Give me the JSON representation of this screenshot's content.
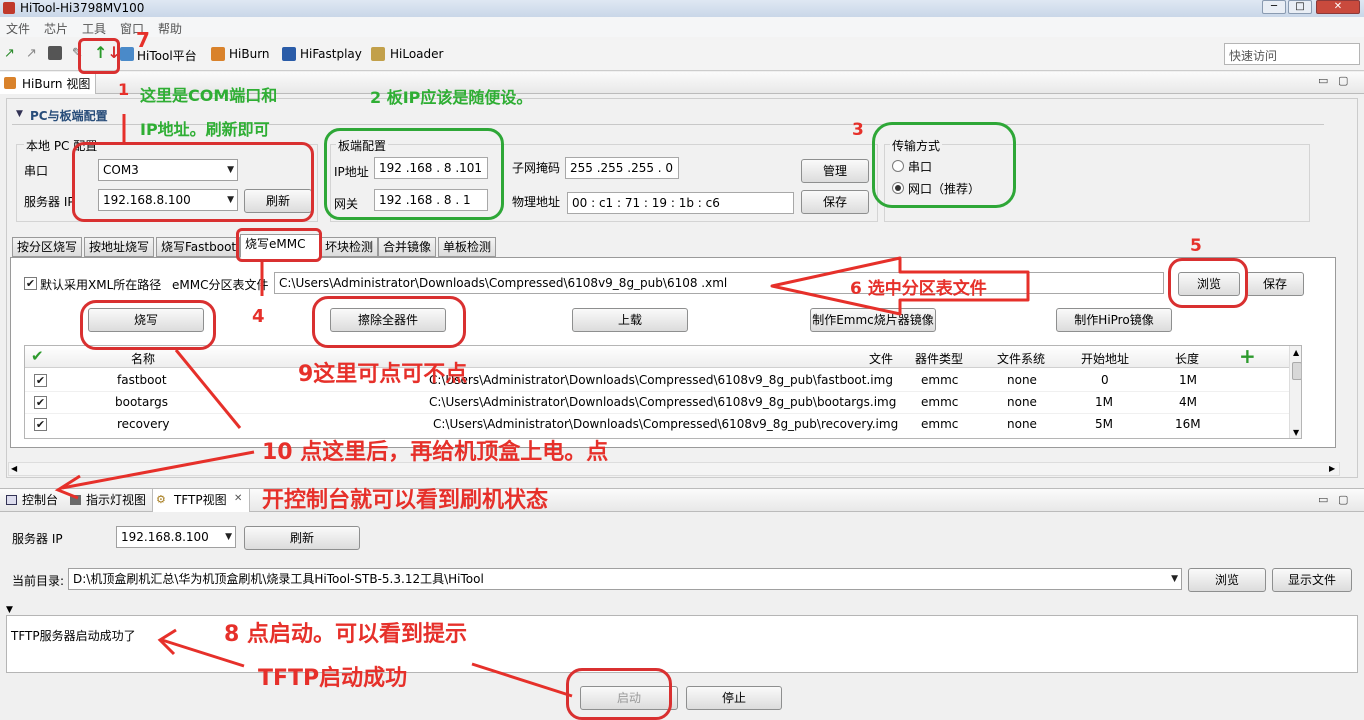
{
  "window": {
    "title": "HiTool-Hi3798MV100"
  },
  "menu": [
    "文件",
    "芯片",
    "工具",
    "窗口",
    "帮助"
  ],
  "toolbar": {
    "items": [
      "HiTool平台",
      "HiBurn",
      "HiFastplay",
      "HiLoader"
    ],
    "quick_access": "快速访问"
  },
  "view": {
    "title": "HiBurn 视图"
  },
  "section": {
    "title": "PC与板端配置"
  },
  "local_pc": {
    "title": "本地 PC 配置",
    "serial_label": "串口",
    "serial_value": "COM3",
    "server_ip_label": "服务器 IP",
    "server_ip_value": "192.168.8.100",
    "refresh": "刷新"
  },
  "board": {
    "title": "板端配置",
    "ip_label": "IP地址",
    "ip_value": "192 .168 . 8 .101",
    "gw_label": "网关",
    "gw_value": "192 .168 . 8 . 1",
    "mask_label": "子网掩码",
    "mask_value": "255 .255 .255 . 0",
    "mac_label": "物理地址",
    "mac_value": "00  :  c1  :  71  :  19  :  1b  :  c6",
    "manage": "管理",
    "save": "保存"
  },
  "transfer": {
    "title": "传输方式",
    "serial": "串口",
    "network": "网口（推荐）"
  },
  "tabs": [
    "按分区烧写",
    "按地址烧写",
    "烧写Fastboot",
    "烧写eMMC",
    "坏块检测",
    "合并镜像",
    "单板检测"
  ],
  "emmc": {
    "default_xml": "默认采用XML所在路径",
    "table_label": "eMMC分区表文件",
    "path": "C:\\Users\\Administrator\\Downloads\\Compressed\\6108v9_8g_pub\\6108 .xml",
    "browse": "浏览",
    "save": "保存",
    "burn": "烧写",
    "erase": "擦除全器件",
    "upload": "上载",
    "make_emmc": "制作Emmc烧片器镜像",
    "make_hipro": "制作HiPro镜像"
  },
  "partition_table": {
    "headers": [
      "名称",
      "文件",
      "器件类型",
      "文件系统",
      "开始地址",
      "长度"
    ],
    "rows": [
      {
        "name": "fastboot",
        "file": "C:\\Users\\Administrator\\Downloads\\Compressed\\6108v9_8g_pub\\fastboot.img",
        "type": "emmc",
        "fs": "none",
        "start": "0",
        "length": "1M"
      },
      {
        "name": "bootargs",
        "file": "C:\\Users\\Administrator\\Downloads\\Compressed\\6108v9_8g_pub\\bootargs.img",
        "type": "emmc",
        "fs": "none",
        "start": "1M",
        "length": "4M"
      },
      {
        "name": "recovery",
        "file": "C:\\Users\\Administrator\\Downloads\\Compressed\\6108v9_8g_pub\\recovery.img",
        "type": "emmc",
        "fs": "none",
        "start": "5M",
        "length": "16M"
      }
    ]
  },
  "bottom_tabs": [
    "控制台",
    "指示灯视图",
    "TFTP视图"
  ],
  "tftp": {
    "server_ip_label": "服务器 IP",
    "server_ip_value": "192.168.8.100",
    "refresh": "刷新",
    "dir_label": "当前目录:",
    "dir_value": "D:\\机顶盒刷机汇总\\华为机顶盒刷机\\烧录工具HiTool-STB-5.3.12工具\\HiTool",
    "browse": "浏览",
    "show_files": "显示文件",
    "log": "TFTP服务器启动成功了",
    "start": "启动",
    "stop": "停止"
  },
  "annotations": {
    "a1_num": "1",
    "a1_line1": "这里是COM端口和",
    "a1_line2": "IP地址。刷新即可",
    "a2": "2 板IP应该是随便设。",
    "a3": "3",
    "a4": "4",
    "a5": "5",
    "a6": "6 选中分区表文件",
    "a7": "7",
    "a8_line1": "8  点启动。可以看到提示",
    "a8_line2": "TFTP启动成功",
    "a9": "9这里可点可不点",
    "a10_line1": "10 点这里后，再给机顶盒上电。点",
    "a10_line2": "开控制台就可以看到刷机状态"
  },
  "colors": {
    "annotation_red": "#e6302a",
    "annotation_green": "#2fae34"
  }
}
